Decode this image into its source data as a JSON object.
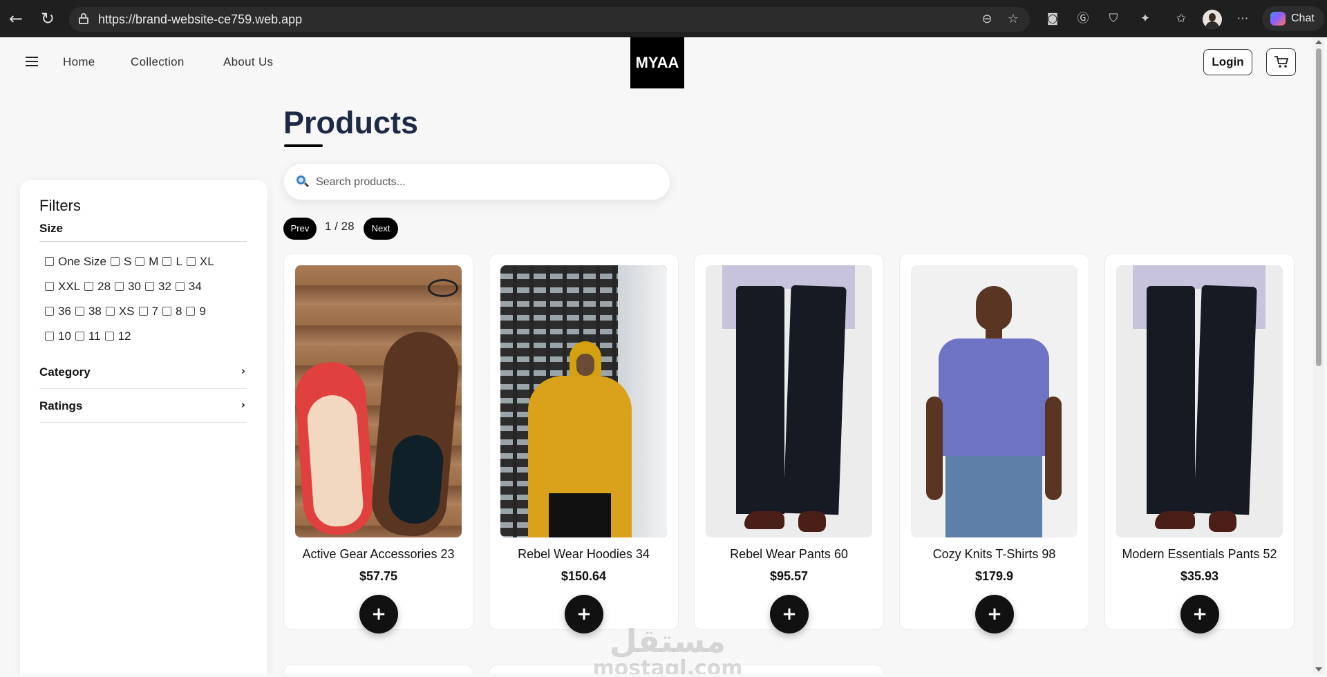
{
  "browser": {
    "url": "https://brand-website-ce759.web.app",
    "chat_label": "Chat"
  },
  "header": {
    "nav": [
      "Home",
      "Collection",
      "About Us"
    ],
    "logo": "MYAA",
    "login_label": "Login"
  },
  "filters": {
    "title": "Filters",
    "size_title": "Size",
    "sizes": [
      "One Size",
      "S",
      "M",
      "L",
      "XL",
      "XXL",
      "28",
      "30",
      "32",
      "34",
      "36",
      "38",
      "XS",
      "7",
      "8",
      "9",
      "10",
      "11",
      "12"
    ],
    "sections": [
      "Category",
      "Ratings"
    ]
  },
  "main": {
    "title": "Products",
    "search_placeholder": "Search products...",
    "pager": {
      "prev": "Prev",
      "page": "1 / 28",
      "next": "Next"
    }
  },
  "products": [
    {
      "name": "Active Gear Accessories 23",
      "price": "$57.75",
      "image": "shoes"
    },
    {
      "name": "Rebel Wear Hoodies 34",
      "price": "$150.64",
      "image": "hoodie"
    },
    {
      "name": "Rebel Wear Pants 60",
      "price": "$95.57",
      "image": "pants"
    },
    {
      "name": "Cozy Knits T-Shirts 98",
      "price": "$179.9",
      "image": "tshirt"
    },
    {
      "name": "Modern Essentials Pants 52",
      "price": "$35.93",
      "image": "pants"
    }
  ],
  "add_label": "+",
  "watermark": {
    "arabic": "مستقل",
    "latin": "mostaql.com"
  }
}
